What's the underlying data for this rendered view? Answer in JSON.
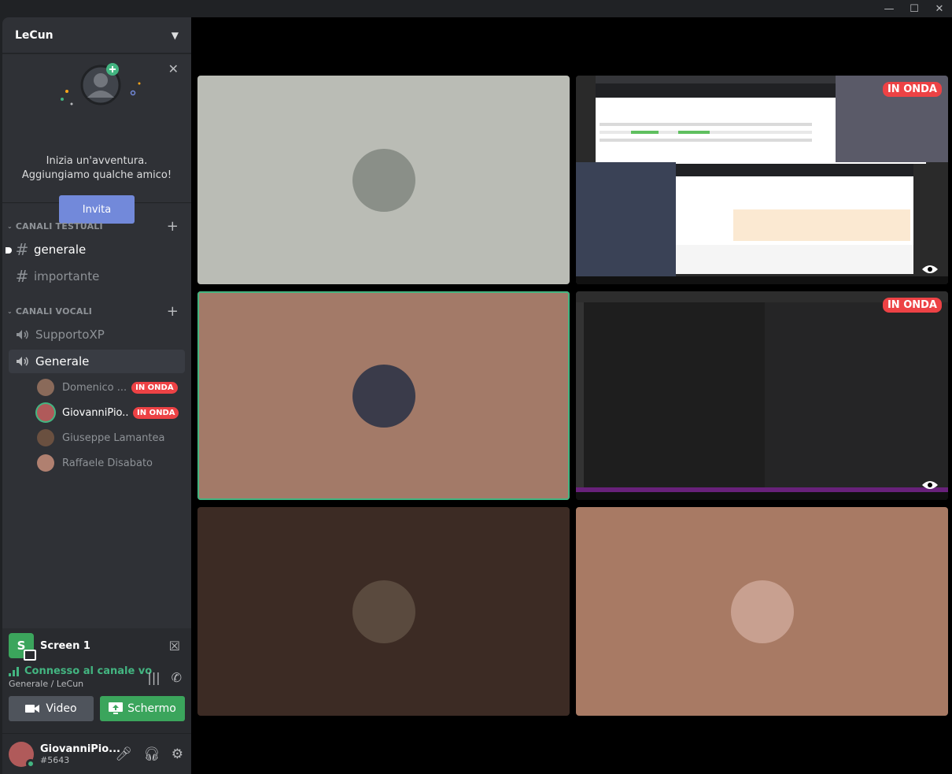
{
  "window": {
    "controls": [
      "minimize",
      "maximize",
      "close"
    ]
  },
  "server": {
    "name": "LeCun"
  },
  "invite": {
    "line1": "Inizia un'avventura.",
    "line2": "Aggiungiamo qualche amico!",
    "button": "Invita"
  },
  "text_channels": {
    "category": "CANALI TESTUALI",
    "items": [
      {
        "name": "generale",
        "unread": true
      },
      {
        "name": "importante",
        "unread": false
      }
    ]
  },
  "voice_channels": {
    "category": "CANALI VOCALI",
    "items": [
      {
        "name": "SupportoXP"
      },
      {
        "name": "Generale",
        "selected": true
      }
    ],
    "members": [
      {
        "name": "Domenico ...",
        "live": "IN ONDA",
        "color": "#8a6a5a"
      },
      {
        "name": "GiovanniPio...",
        "live": "IN ONDA",
        "color": "#b05a5a",
        "speaking": true
      },
      {
        "name": "Giuseppe Lamantea",
        "color": "#6a5040"
      },
      {
        "name": "Raffaele Disabato",
        "color": "#b08070"
      }
    ]
  },
  "screen_panel": {
    "icon_letter": "S",
    "name": "Screen 1"
  },
  "connection": {
    "status": "Connesso al canale vo",
    "location": "Generale / LeCun"
  },
  "buttons": {
    "video": "Video",
    "screen": "Schermo"
  },
  "user": {
    "name": "GiovanniPio...",
    "tag": "#5643"
  },
  "tiles": [
    {
      "bg": "#babcb5",
      "kind": "avatar",
      "avatar_color": "#8a8f88"
    },
    {
      "bg": "#2b2b2b",
      "kind": "screen",
      "live": "IN ONDA"
    },
    {
      "bg": "#a37a68",
      "kind": "avatar",
      "speaking": true,
      "avatar_color": "#3a3b4a"
    },
    {
      "bg": "#1e1e1e",
      "kind": "screen",
      "live": "IN ONDA"
    },
    {
      "bg": "#3c2b24",
      "kind": "avatar",
      "avatar_color": "#5a4a3e"
    },
    {
      "bg": "#a87a64",
      "kind": "avatar",
      "avatar_color": "#c8a090"
    }
  ],
  "colors": {
    "accent": "#7289da",
    "green": "#43b581",
    "live": "#ed4245"
  }
}
